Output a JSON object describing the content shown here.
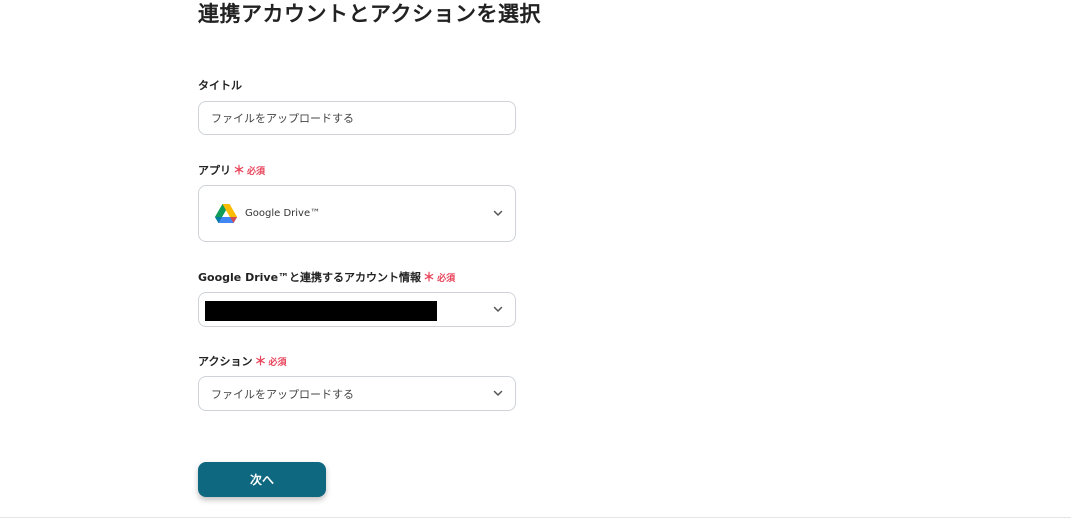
{
  "page": {
    "title": "連携アカウントとアクションを選択"
  },
  "fields": {
    "title": {
      "label": "タイトル",
      "value": "ファイルをアップロードする"
    },
    "app": {
      "label": "アプリ",
      "required_mark": "＊",
      "required_text": "必須",
      "value": "Google Drive™",
      "icon": "google-drive-icon"
    },
    "account": {
      "label": "Google Drive™と連携するアカウント情報",
      "required_mark": "＊",
      "required_text": "必須",
      "value_redacted": true
    },
    "action": {
      "label": "アクション",
      "required_mark": "＊",
      "required_text": "必須",
      "value": "ファイルをアップロードする"
    }
  },
  "buttons": {
    "next_label": "次へ"
  },
  "colors": {
    "primary": "#0e6880",
    "required": "#e8445a",
    "border": "#cfd3d8"
  }
}
